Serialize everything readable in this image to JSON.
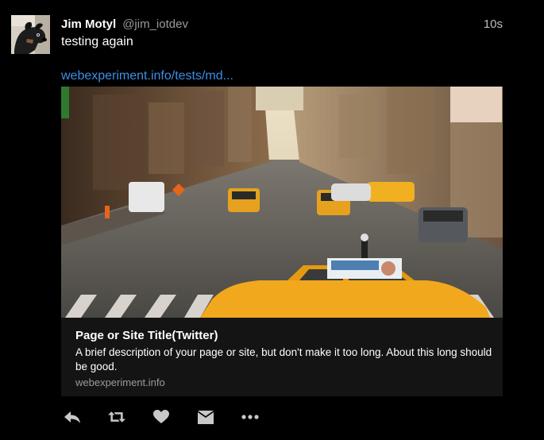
{
  "tweet": {
    "author": {
      "display_name": "Jim Motyl",
      "handle": "@jim_iotdev",
      "avatar_icon": "dog-photo-avatar"
    },
    "timestamp": "10s",
    "text": "testing again",
    "link_text": "webexperiment.info/tests/md..."
  },
  "card": {
    "image_icon": "city-street-taxi-photo",
    "title": "Page or Site Title(Twitter)",
    "description": "A brief description of your page or site, but don't make it too long. About this long should be good.",
    "domain": "webexperiment.info"
  },
  "actions": [
    {
      "name": "reply",
      "icon": "reply-icon"
    },
    {
      "name": "retweet",
      "icon": "retweet-icon"
    },
    {
      "name": "like",
      "icon": "heart-icon"
    },
    {
      "name": "direct-message",
      "icon": "envelope-icon"
    },
    {
      "name": "more",
      "icon": "more-icon"
    }
  ],
  "colors": {
    "background": "#000000",
    "link": "#3d8ee6",
    "card_background": "#141414",
    "muted_text": "#9a9a9a",
    "icon": "#c8c8c8",
    "taxi_yellow": "#f2a81d"
  }
}
